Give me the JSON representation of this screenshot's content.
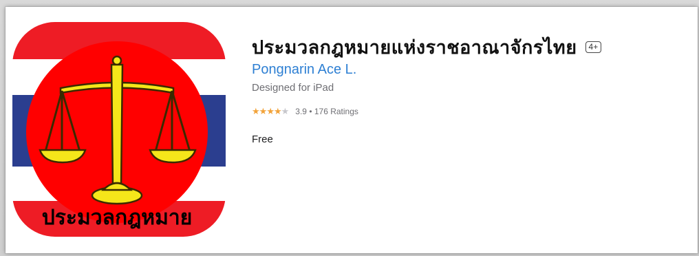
{
  "app": {
    "title": "ประมวลกฎหมายแห่งราชอาณาจักรไทย",
    "age_rating": "4+",
    "developer": "Pongnarin Ace L.",
    "designed_for": "Designed for iPad",
    "rating_value": "3.9",
    "rating_separator": "•",
    "rating_count": "176 Ratings",
    "stars": 4,
    "stars_max": 5,
    "price": "Free"
  },
  "icon": {
    "label": "ประมวลกฎหมาย",
    "semantic": "scales-of-justice-icon",
    "colors": {
      "flag_red": "#ee1c25",
      "flag_blue": "#2b3e8f",
      "circle_red": "#ff0000",
      "scales": "#f5e61a",
      "label_text": "#000000"
    }
  },
  "colors": {
    "developer_link": "#2d7fd3",
    "star_filled": "#f2a33a",
    "star_empty": "#c7c7cc"
  }
}
